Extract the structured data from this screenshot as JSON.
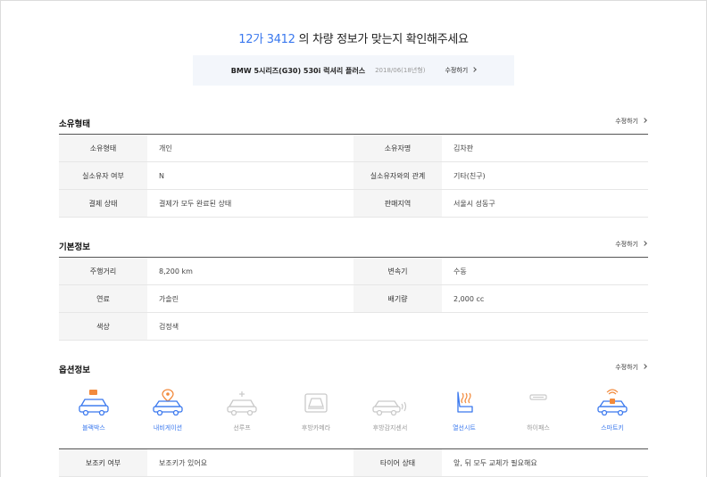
{
  "header": {
    "plate": "12가 3412",
    "message": " 의 차량 정보가 맞는지 확인해주세요"
  },
  "car": {
    "model": "BMW 5시리즈(G30) 530i 럭셔리 플러스",
    "date": "2018/06(18년형)",
    "edit_label": "수정하기"
  },
  "ownership": {
    "title": "소유형태",
    "edit_label": "수정하기",
    "rows": [
      [
        {
          "k": "소유형태",
          "v": "개인"
        },
        {
          "k": "소유자명",
          "v": "김차판"
        }
      ],
      [
        {
          "k": "실소유자 여부",
          "v": "N"
        },
        {
          "k": "실소유자와의 관계",
          "v": "기타(친구)"
        }
      ],
      [
        {
          "k": "결제 상태",
          "v": "결제가 모두 완료된 상태"
        },
        {
          "k": "판매지역",
          "v": "서울시 성동구"
        }
      ]
    ]
  },
  "basic": {
    "title": "기본정보",
    "edit_label": "수정하기",
    "rows": [
      [
        {
          "k": "주행거리",
          "v": "8,200 km"
        },
        {
          "k": "변속기",
          "v": "수동"
        }
      ],
      [
        {
          "k": "연료",
          "v": "가솔린"
        },
        {
          "k": "배기량",
          "v": "2,000 cc"
        }
      ],
      [
        {
          "k": "색상",
          "v": "검정색"
        }
      ]
    ]
  },
  "options": {
    "title": "옵션정보",
    "edit_label": "수정하기",
    "accent_color": "#3a78ee",
    "secondary_color": "#f28a3c",
    "inactive_color": "#c9c9c9",
    "items": [
      {
        "label": "블랙박스",
        "icon": "blackbox-car-icon",
        "active": true
      },
      {
        "label": "내비게이션",
        "icon": "navigation-car-icon",
        "active": true
      },
      {
        "label": "선루프",
        "icon": "sunroof-car-icon",
        "active": false
      },
      {
        "label": "후방카메라",
        "icon": "rear-camera-icon",
        "active": false
      },
      {
        "label": "후방감지센서",
        "icon": "rear-sensor-icon",
        "active": false
      },
      {
        "label": "열선시트",
        "icon": "heated-seat-icon",
        "active": true
      },
      {
        "label": "하이패스",
        "icon": "hipass-icon",
        "active": false
      },
      {
        "label": "스마트키",
        "icon": "smart-key-car-icon",
        "active": true
      }
    ]
  },
  "extra": {
    "rows": [
      [
        {
          "k": "보조키 여부",
          "v": "보조키가 있어요"
        },
        {
          "k": "타이어 상태",
          "v": "앞, 뒤 모두 교체가 필요해요"
        }
      ]
    ]
  }
}
